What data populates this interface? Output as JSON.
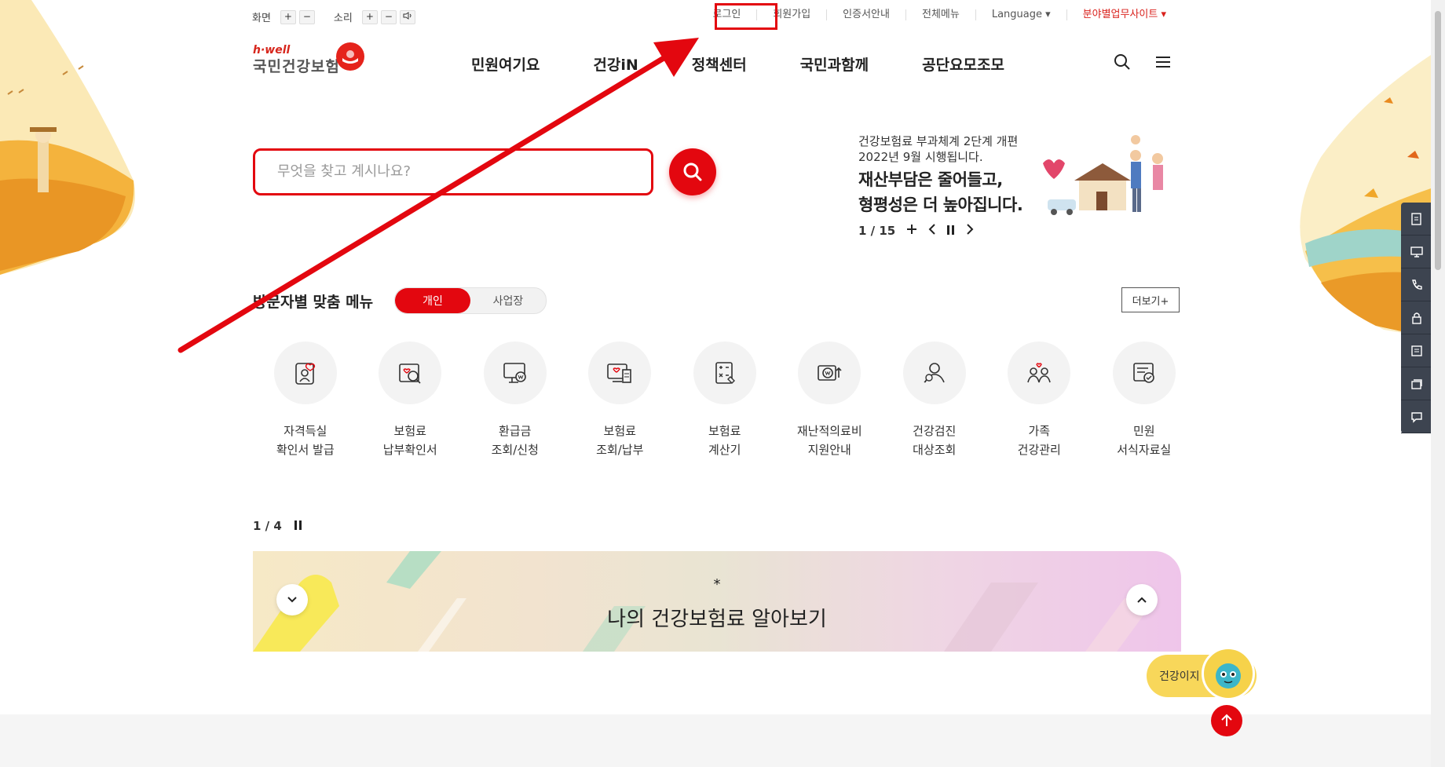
{
  "colors": {
    "brand_red": "#e3070f",
    "quick_menu_bg": "#3d4450",
    "chatbot_yellow": "#f8d75a"
  },
  "utility": {
    "screen_label": "화면",
    "sound_label": "소리",
    "plus": "+",
    "minus": "−",
    "links": {
      "login": "로그인",
      "join": "회원가입",
      "cert": "인증서안내",
      "all_menu": "전체메뉴",
      "language": "Language ▾",
      "sites": "분야별업무사이트 ▾"
    }
  },
  "logo": {
    "brand_small": "h·well",
    "name": "국민건강보험"
  },
  "gnb": [
    "민원여기요",
    "건강iN",
    "정책센터",
    "국민과함께",
    "공단요모조모"
  ],
  "search": {
    "placeholder": "무엇을 찾고 계시나요?"
  },
  "banner": {
    "sub1": "건강보험료 부과체계 2단계 개편",
    "sub2": "2022년 9월 시행됩니다.",
    "head1": "재산부담은 줄어들고,",
    "head2": "형평성은 더 높아집니다.",
    "pager": "1 / 15"
  },
  "visitor_menu": {
    "title": "방문자별 맞춤 메뉴",
    "tab_personal": "개인",
    "tab_business": "사업장",
    "more": "더보기+",
    "items": [
      {
        "l1": "자격득실",
        "l2": "확인서 발급",
        "icon": "id-card-icon"
      },
      {
        "l1": "보험료",
        "l2": "납부확인서",
        "icon": "search-document-icon"
      },
      {
        "l1": "환급금",
        "l2": "조회/신청",
        "icon": "monitor-won-icon"
      },
      {
        "l1": "보험료",
        "l2": "조회/납부",
        "icon": "bill-monitor-icon"
      },
      {
        "l1": "보험료",
        "l2": "계산기",
        "icon": "calculator-icon"
      },
      {
        "l1": "재난적의료비",
        "l2": "지원안내",
        "icon": "money-support-icon"
      },
      {
        "l1": "건강검진",
        "l2": "대상조회",
        "icon": "person-search-icon"
      },
      {
        "l1": "가족",
        "l2": "건강관리",
        "icon": "family-icon"
      },
      {
        "l1": "민원",
        "l2": "서식자료실",
        "icon": "form-folder-icon"
      }
    ]
  },
  "slider": {
    "pager": "1 / 4",
    "mark": "*",
    "text": "나의 건강보험료 알아보기"
  },
  "chatbot": {
    "label": "건강이지"
  }
}
